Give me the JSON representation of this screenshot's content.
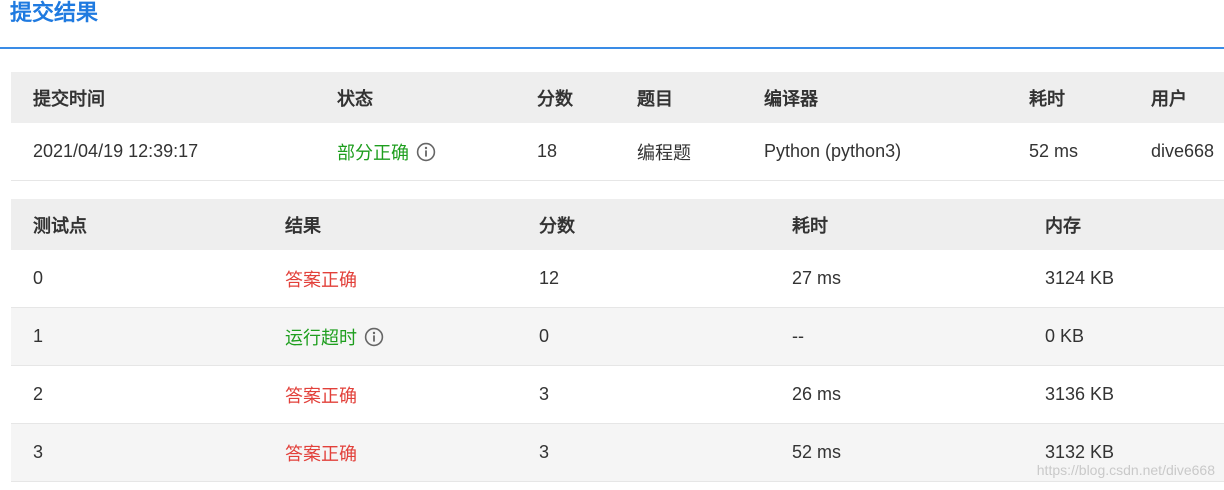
{
  "page": {
    "title": "提交结果",
    "accent_color": "#1f7ae0"
  },
  "submission": {
    "columns": [
      "提交时间",
      "状态",
      "分数",
      "题目",
      "编译器",
      "耗时",
      "用户"
    ],
    "row": {
      "submit_time": "2021/04/19 12:39:17",
      "status": "部分正确",
      "status_color": "#1e9e1e",
      "status_icon": "info-circle-icon",
      "score": "18",
      "problem": "编程题",
      "compiler": "Python (python3)",
      "elapsed": "52 ms",
      "user": "dive668"
    }
  },
  "testcases": {
    "columns": [
      "测试点",
      "结果",
      "分数",
      "耗时",
      "内存"
    ],
    "rows": [
      {
        "id": "0",
        "result": "答案正确",
        "result_color": "#e2403a",
        "score": "12",
        "time": "27 ms",
        "memory": "3124 KB"
      },
      {
        "id": "1",
        "result": "运行超时",
        "result_color": "#1e9e1e",
        "result_icon": "info-circle-icon",
        "score": "0",
        "time": "--",
        "memory": "0 KB"
      },
      {
        "id": "2",
        "result": "答案正确",
        "result_color": "#e2403a",
        "score": "3",
        "time": "26 ms",
        "memory": "3136 KB"
      },
      {
        "id": "3",
        "result": "答案正确",
        "result_color": "#e2403a",
        "score": "3",
        "time": "52 ms",
        "memory": "3132 KB"
      }
    ]
  },
  "watermark": "https://blog.csdn.net/dive668"
}
